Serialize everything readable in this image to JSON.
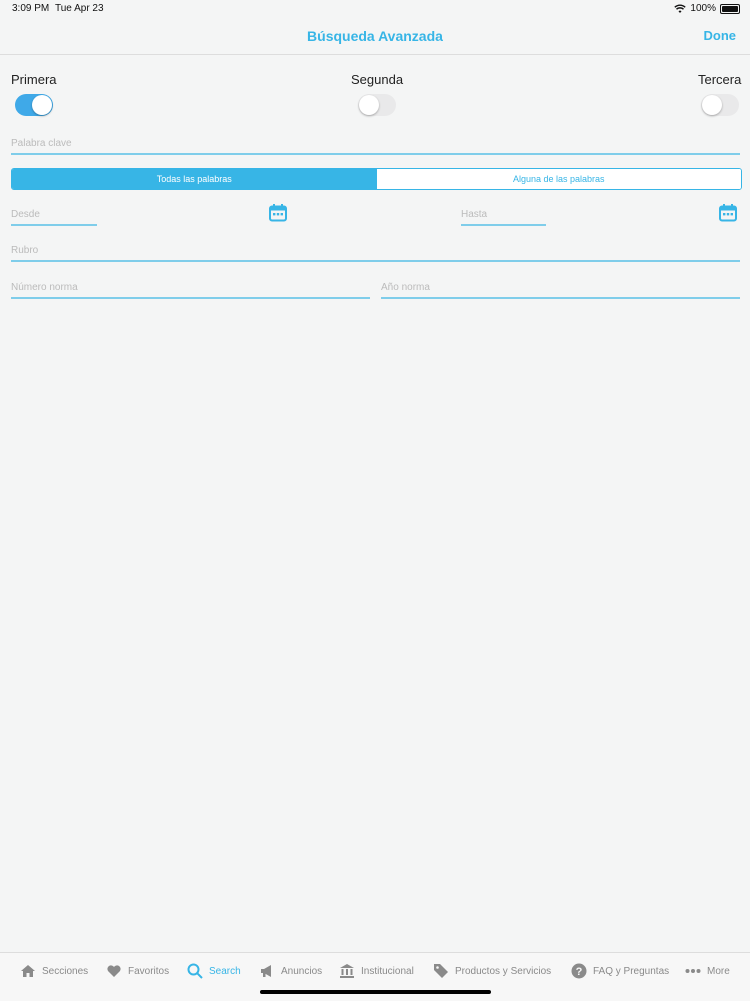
{
  "status": {
    "time": "3:09 PM",
    "date": "Tue Apr 23",
    "battery": "100%"
  },
  "nav": {
    "title": "Búsqueda Avanzada",
    "done_label": "Done"
  },
  "toggles": [
    {
      "label": "Primera",
      "on": true
    },
    {
      "label": "Segunda",
      "on": false
    },
    {
      "label": "Tercera",
      "on": false
    }
  ],
  "fields": {
    "keyword_placeholder": "Palabra clave",
    "desde_placeholder": "Desde",
    "hasta_placeholder": "Hasta",
    "rubro_placeholder": "Rubro",
    "numero_placeholder": "Número norma",
    "anio_placeholder": "Año norma"
  },
  "segment": {
    "options": [
      "Todas las palabras",
      "Alguna de las palabras"
    ],
    "selected": "Todas las palabras"
  },
  "tabs": [
    {
      "label": "Secciones",
      "icon": "home-icon"
    },
    {
      "label": "Favoritos",
      "icon": "heart-icon"
    },
    {
      "label": "Search",
      "icon": "search-icon",
      "active": true
    },
    {
      "label": "Anuncios",
      "icon": "megaphone-icon"
    },
    {
      "label": "Institucional",
      "icon": "institution-icon"
    },
    {
      "label": "Productos y Servicios",
      "icon": "tag-icon"
    },
    {
      "label": "FAQ y Preguntas",
      "icon": "question-icon"
    },
    {
      "label": "More",
      "icon": "more-icon"
    }
  ],
  "colors": {
    "accent": "#37b5e6",
    "switch_on": "#3fa9e8",
    "background": "#f4f5f5"
  }
}
